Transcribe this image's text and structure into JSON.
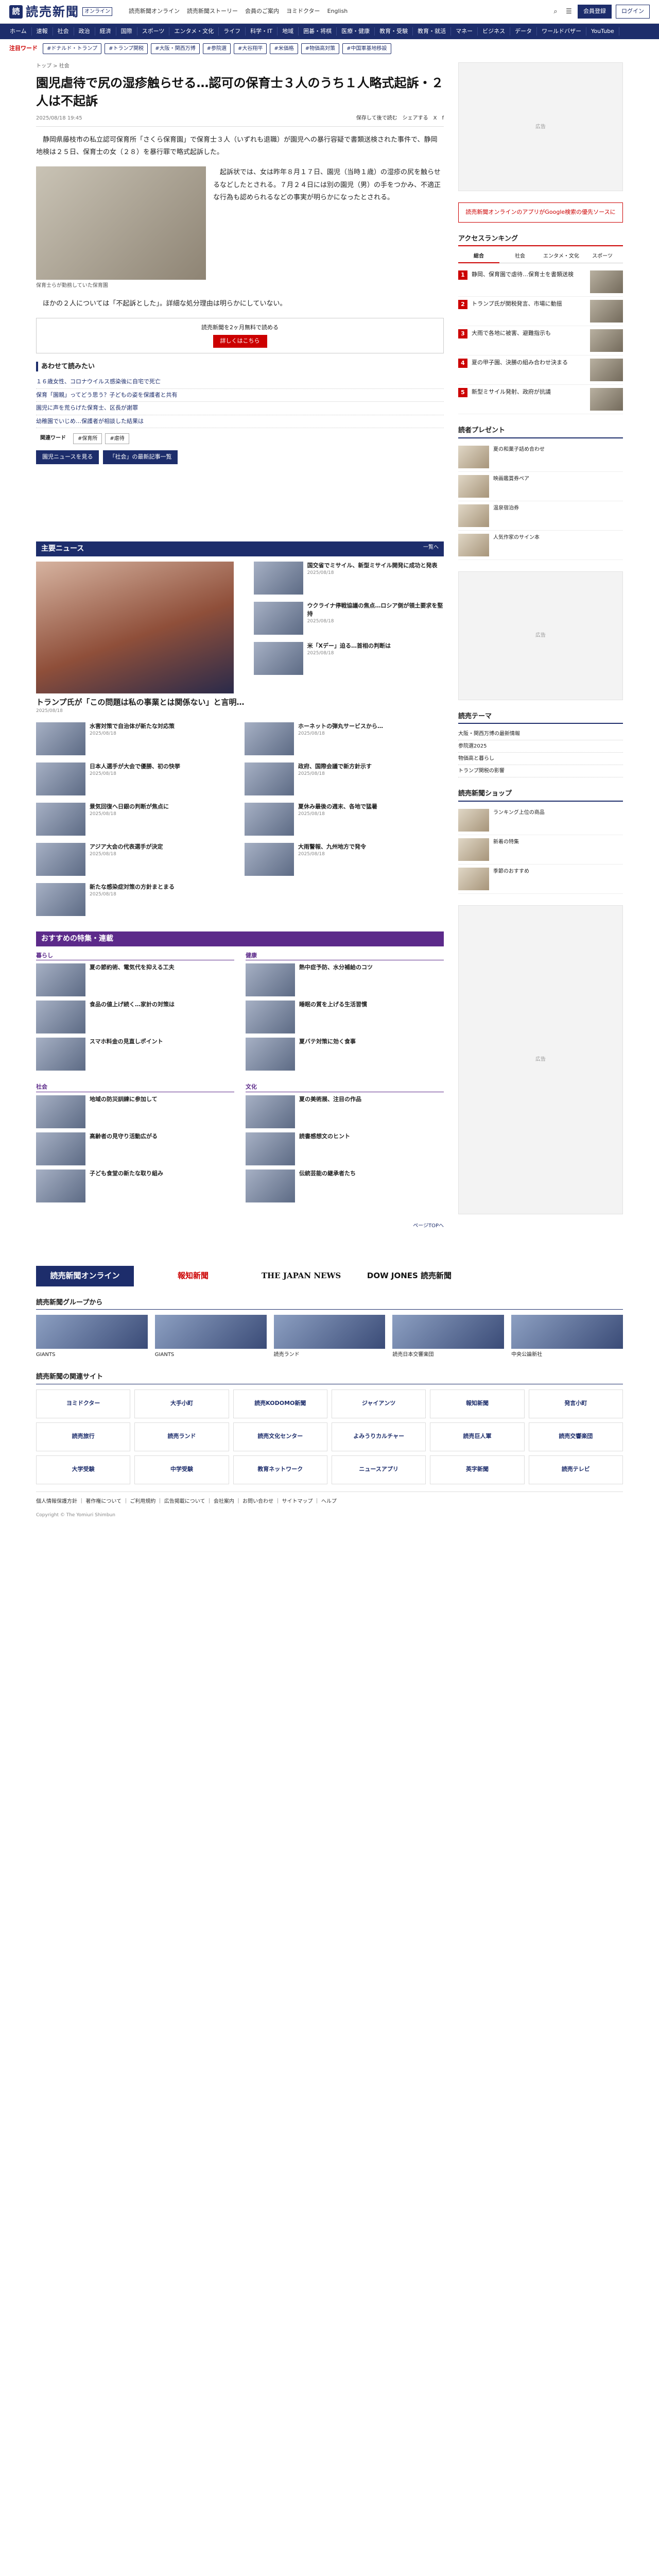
{
  "header": {
    "logo_mark": "読",
    "logo_text": "読売新聞",
    "logo_sub": "オンライン",
    "nav": [
      "読売新聞オンライン",
      "読売新聞ストーリー",
      "会員のご案内",
      "ヨミドクター",
      "English",
      "会員登録",
      "ログイン"
    ],
    "login": "ログイン",
    "register": "会員登録",
    "search_icon": "⌕"
  },
  "gnav": [
    "ホーム",
    "速報",
    "社会",
    "政治",
    "経済",
    "国際",
    "スポーツ",
    "エンタメ・文化",
    "ライフ",
    "科学・IT",
    "地域",
    "囲碁・将棋",
    "医療・健康",
    "教育・受験",
    "教育・就活",
    "マネー",
    "ビジネス",
    "データ",
    "ワールドバザー",
    "YouTube"
  ],
  "tags": {
    "label": "注目ワード",
    "items": [
      "#ドナルド・トランプ",
      "#トランプ関税",
      "#大阪・関西万博",
      "#参院選",
      "#大谷翔平",
      "#米価格",
      "#物価高対策",
      "#中国軍基地移設"
    ]
  },
  "article": {
    "breadcrumb": "トップ > 社会",
    "title": "園児虐待で尻の湿疹触らせる…認可の保育士３人のうち１人略式起訴・２人は不起訴",
    "date": "2025/08/18 19:45",
    "share": [
      "保存して後で読む",
      "シェアする",
      "X",
      "f"
    ],
    "p1": "静岡県藤枝市の私立認可保育所「さくら保育園」で保育士３人（いずれも退職）が園児への暴行容疑で書類送検された事件で、静岡地検は２５日、保育士の女（２８）を暴行罪で略式起訴した。",
    "fig_cap": "保育士らが勤務していた保育園",
    "p2": "起訴状では、女は昨年８月１７日、園児（当時１歳）の湿疹の尻を触らせるなどしたとされる。７月２４日には別の園児（男）の手をつかみ、不適正な行為も認められるなどの事実が明らかになったとされる。",
    "p3": "ほかの２人については「不起訴とした」。詳細な処分理由は明らかにしていない。",
    "promo_text": "読売新聞を2ヶ月無料で読める",
    "promo_btn": "詳しくはこちら",
    "related_title": "あわせて読みたい",
    "related": [
      "１６歳女性、コロナウイルス感染後に自宅で死亡",
      "保育「園親」ってどう思う？子どもの姿を保護者と共有",
      "園児に声を荒らげた保育士、区長が謝罪",
      "幼稚園でいじめ…保護者が相談した結果は"
    ],
    "kw_label": "関連ワード",
    "kw": [
      "#保育所",
      "#虐待"
    ],
    "btns": [
      "園児ニュースを見る",
      "「社会」の最新記事一覧"
    ]
  },
  "main_news": {
    "title": "主要ニュース",
    "more": "一覧へ",
    "lead": {
      "title": "トランプ氏が「この問題は私の事業とは関係ない」と言明…",
      "date": "2025/08/18"
    },
    "items": [
      {
        "t": "国交省でミサイル、新型ミサイル開発に成功と発表",
        "d": "2025/08/18"
      },
      {
        "t": "ウクライナ停戦協議の焦点…ロシア側が領土要求を堅持",
        "d": "2025/08/18"
      },
      {
        "t": "米「Xデー」迫る…首相の判断は",
        "d": "2025/08/18"
      },
      {
        "t": "水害対策で自治体が新たな対応策",
        "d": "2025/08/18"
      },
      {
        "t": "ホーネットの弾丸サービスから…",
        "d": "2025/08/18"
      },
      {
        "t": "日本人選手が大会で優勝、初の快挙",
        "d": "2025/08/18"
      },
      {
        "t": "政府、国際会議で新方針示す",
        "d": "2025/08/18"
      },
      {
        "t": "景気回復へ日銀の判断が焦点に",
        "d": "2025/08/18"
      },
      {
        "t": "夏休み最後の週末、各地で猛暑",
        "d": "2025/08/18"
      },
      {
        "t": "アジア大会の代表選手が決定",
        "d": "2025/08/18"
      },
      {
        "t": "大雨警報、九州地方で発令",
        "d": "2025/08/18"
      },
      {
        "t": "新たな感染症対策の方針まとまる",
        "d": "2025/08/18"
      }
    ]
  },
  "reco": {
    "title": "おすすめの特集・連載",
    "more": "ページTOPへ",
    "cols": [
      {
        "h": "暮らし",
        "items": [
          "夏の節約術、電気代を抑える工夫",
          "食品の値上げ続く…家計の対策は",
          "スマホ料金の見直しポイント"
        ]
      },
      {
        "h": "健康",
        "items": [
          "熱中症予防、水分補給のコツ",
          "睡眠の質を上げる生活習慣",
          "夏バテ対策に効く食事"
        ]
      },
      {
        "h": "社会",
        "items": [
          "地域の防災訓練に参加して",
          "高齢者の見守り活動広がる",
          "子ども食堂の新たな取り組み"
        ]
      },
      {
        "h": "文化",
        "items": [
          "夏の美術展、注目の作品",
          "読書感想文のヒント",
          "伝統芸能の継承者たち"
        ]
      }
    ]
  },
  "side": {
    "ad1": "広告",
    "banner": "読売新聞オンラインのアプリがGoogle検索の優先ソースに",
    "ranking": {
      "title": "アクセスランキング",
      "tabs": [
        "総合",
        "社会",
        "エンタメ・文化",
        "スポーツ"
      ],
      "items": [
        "静岡、保育園で虐待…保育士を書類送検",
        "トランプ氏が関税発言、市場に動揺",
        "大雨で各地に被害、避難指示も",
        "夏の甲子園、決勝の組み合わせ決まる",
        "新型ミサイル発射、政府が抗議"
      ]
    },
    "gift": {
      "title": "読者プレゼント",
      "items": [
        "夏の和菓子詰め合わせ",
        "映画鑑賞券ペア",
        "温泉宿泊券",
        "人気作家のサイン本"
      ]
    },
    "pickup": {
      "title": "読売テーマ",
      "items": [
        "大阪・関西万博の最新情報",
        "参院選2025",
        "物価高と暮らし",
        "トランプ関税の影響"
      ]
    },
    "shop": {
      "title": "読売新聞ショップ",
      "items": [
        "ランキング上位の商品",
        "新着の特集",
        "季節のおすすめ"
      ]
    }
  },
  "footer": {
    "group_title": "読売新聞グループから",
    "site_title": "読売新聞の関連サイト",
    "logos": [
      "読売新聞オンライン",
      "報知新聞",
      "THE JAPAN NEWS",
      "DOW JONES 読売新聞"
    ],
    "groups": [
      "GIANTS",
      "GIANTS",
      "読売ランド",
      "読売日本交響楽団",
      "中央公論新社"
    ],
    "sites": [
      "ヨミドクター",
      "大手小町",
      "読売KODOMO新聞",
      "ジャイアンツ",
      "報知新聞",
      "発言小町",
      "読売旅行",
      "読売ランド",
      "読売文化センター",
      "よみうりカルチャー",
      "読売巨人軍",
      "読売交響楽団",
      "大学受験",
      "中学受験",
      "教育ネットワーク",
      "ニュースアプリ",
      "英字新聞",
      "読売テレビ"
    ],
    "links": "個人情報保護方針 ｜ 著作権について ｜ ご利用規約 ｜ 広告掲載について ｜ 会社案内 ｜ お問い合わせ ｜ サイトマップ ｜ ヘルプ",
    "copy": "Copyright © The Yomiuri Shimbun"
  }
}
